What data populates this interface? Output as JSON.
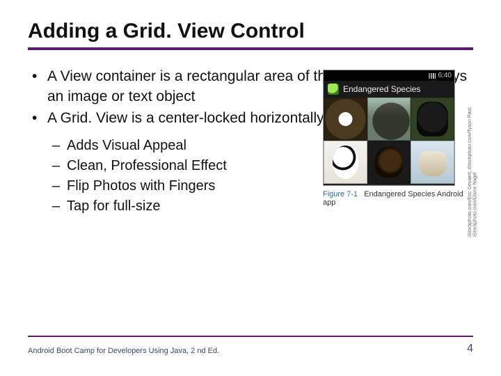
{
  "title": "Adding a Grid. View Control",
  "bullets": [
    "A View container is a rectangular area of the screen that displays an image or text object",
    "A Grid. View is a center-locked horizontally scrolling list"
  ],
  "sub_bullets": [
    "Adds Visual Appeal",
    "Clean, Professional Effect",
    "Flip Photos with Fingers",
    "Tap for full-size"
  ],
  "phone": {
    "time": "6:40",
    "app_title": "Endangered Species"
  },
  "figure": {
    "label": "Figure 7-1",
    "caption": "Endangered Species Android app",
    "credit": "iStockphoto.com/Eric Gevaert; iStockphoto.com/Tyson Paul; iStockphoto.com/Glenn Nagel"
  },
  "footer": {
    "source": "Android Boot Camp for Developers Using Java, 2 nd Ed.",
    "page": "4"
  }
}
